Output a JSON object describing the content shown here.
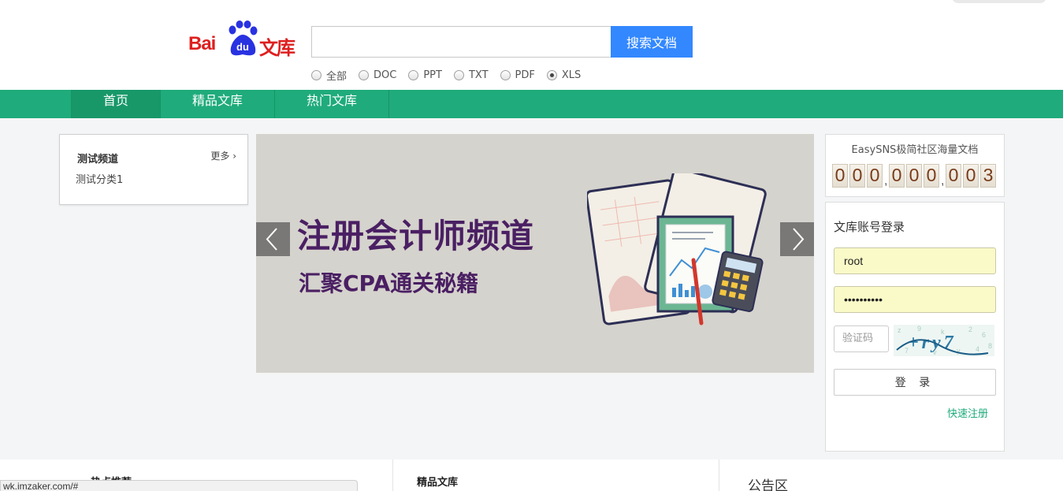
{
  "header": {
    "logo_text_left": "Bai",
    "logo_text_paw": "du",
    "logo_text_right": "文库",
    "search_placeholder": "",
    "search_value": "",
    "search_button": "搜索文档",
    "types": [
      {
        "label": "全部",
        "checked": false
      },
      {
        "label": "DOC",
        "checked": false
      },
      {
        "label": "PPT",
        "checked": false
      },
      {
        "label": "TXT",
        "checked": false
      },
      {
        "label": "PDF",
        "checked": false
      },
      {
        "label": "XLS",
        "checked": true
      }
    ]
  },
  "nav": {
    "items": [
      {
        "label": "首页",
        "active": true
      },
      {
        "label": "精品文库",
        "active": false
      },
      {
        "label": "热门文库",
        "active": false
      }
    ]
  },
  "category": {
    "title": "测试频道",
    "more": "更多 ›",
    "items": [
      "测试分类1"
    ]
  },
  "banner": {
    "headline": "注册会计师频道",
    "subline": "汇聚CPA通关秘籍"
  },
  "counter": {
    "title": "EasySNS极简社区海量文档",
    "digits": [
      "0",
      "0",
      "0",
      ",",
      "0",
      "0",
      "0",
      ",",
      "0",
      "0",
      "3"
    ]
  },
  "login": {
    "title": "文库账号登录",
    "username": "root",
    "password_mask": "••••••••••",
    "captcha_placeholder": "验证码",
    "captcha_text": "+ry7",
    "submit": "登 录",
    "register": "快速注册"
  },
  "bottom": {
    "hot_title": "热点推荐",
    "premium_title": "精品文库",
    "notice_title": "公告区"
  },
  "status_url": "wk.imzaker.com/#",
  "colors": {
    "brand_green": "#1fab7b",
    "search_blue": "#3388ff",
    "logo_red": "#de1f1f",
    "banner_purple": "#4a1f63"
  }
}
